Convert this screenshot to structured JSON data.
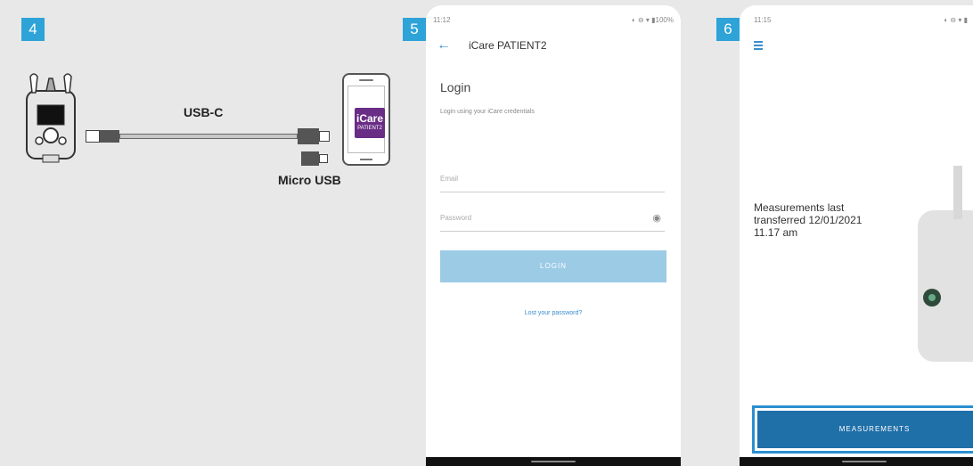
{
  "colors": {
    "step_badge": "#2ea3d8",
    "app_icon": "#6a2d86",
    "accent": "#3a8fd0",
    "login_button": "#9ccbe6",
    "measurements_button": "#1f6fa8"
  },
  "panel4": {
    "step": "4",
    "usb_c_label": "USB-C",
    "micro_usb_label": "Micro USB",
    "app_icon_line1": "iCare",
    "app_icon_line2": "PATIENT2"
  },
  "panel5": {
    "step": "5",
    "status_left": "11:12",
    "status_right": "◐ ⊖ ▾ ▮100%",
    "app_title": "iCare PATIENT2",
    "heading": "Login",
    "subtitle": "Login using your iCare credentials",
    "email_placeholder": "Email",
    "password_placeholder": "Password",
    "login_button": "LOGIN",
    "lost_password": "Lost your password?",
    "icons": [
      "back-arrow-icon",
      "eye-icon"
    ]
  },
  "panel6": {
    "step": "6",
    "status_left": "11:15",
    "status_right": "◐ ⊖ ▾ ▮",
    "measurements_text": "Measurements last transferred 12/01/2021 11.17 am",
    "measurements_button": "MEASUREMENTS",
    "icons": [
      "menu-icon"
    ]
  }
}
